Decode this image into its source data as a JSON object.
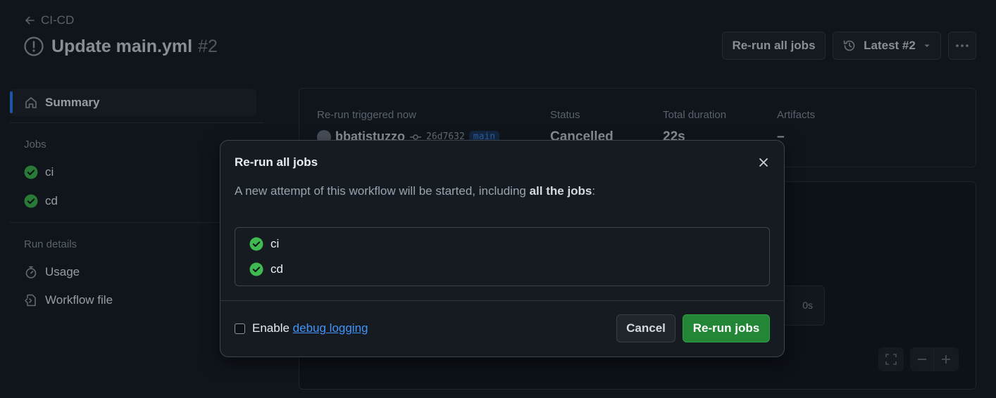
{
  "header": {
    "back_label": "CI-CD",
    "title": "Update main.yml",
    "run_number": "#2",
    "rerun_all_label": "Re-run all jobs",
    "latest_label": "Latest #2"
  },
  "sidebar": {
    "summary_label": "Summary",
    "jobs_heading": "Jobs",
    "jobs": [
      {
        "label": "ci"
      },
      {
        "label": "cd"
      }
    ],
    "run_details_heading": "Run details",
    "details": [
      {
        "label": "Usage",
        "icon": "stopwatch-icon"
      },
      {
        "label": "Workflow file",
        "icon": "file-code-icon"
      }
    ]
  },
  "summary": {
    "trigger_label": "Re-run triggered now",
    "actor": "bbatistuzzo",
    "commit": "26d7632",
    "branch": "main",
    "status_label": "Status",
    "status_value": "Cancelled",
    "duration_label": "Total duration",
    "duration_value": "22s",
    "artifacts_label": "Artifacts",
    "artifacts_value": "–"
  },
  "graph": {
    "job_duration": "0s"
  },
  "modal": {
    "title": "Re-run all jobs",
    "desc_prefix": "A new attempt of this workflow will be started, including ",
    "desc_bold": "all the jobs",
    "desc_suffix": ":",
    "jobs": [
      {
        "label": "ci"
      },
      {
        "label": "cd"
      }
    ],
    "debug_prefix": "Enable ",
    "debug_link": "debug logging",
    "debug_checked": false,
    "cancel_label": "Cancel",
    "rerun_label": "Re-run jobs"
  },
  "colors": {
    "background": "#1a1f27",
    "accent_blue": "#2f81f7",
    "success_green": "#3fb950",
    "primary_button": "#238636"
  }
}
